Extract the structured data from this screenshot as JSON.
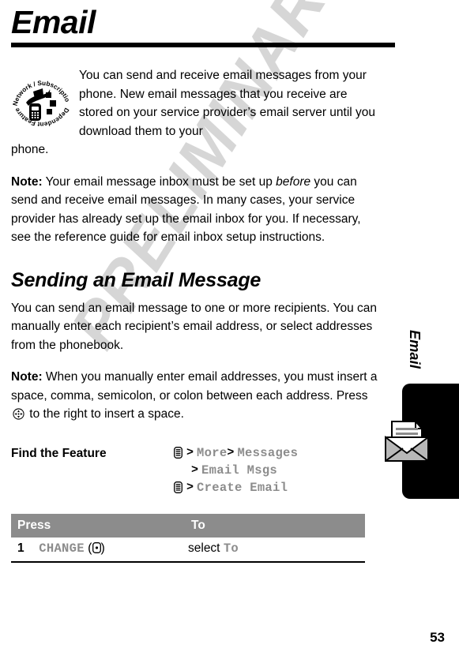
{
  "page": {
    "chapter_title": "Email",
    "page_number": "53",
    "watermark": "PRELIMINARY"
  },
  "badge": {
    "icon": "network-subscription-dependent-feature-badge",
    "top_text": "Network / Subscription",
    "bottom_text": "Dependent Feature"
  },
  "intro": {
    "text": "You can send and receive email messages from your phone. New email messages that you receive are stored on your service provider’s email server until you download them to your",
    "tail": "phone."
  },
  "note1": {
    "label": "Note:",
    "part1": "Your email message inbox must be set up ",
    "emphasis": "before",
    "part2": " you can send and receive email messages. In many cases, your service provider has already set up the email inbox for you. If necessary, see the reference guide for email inbox setup instructions."
  },
  "section": {
    "heading": "Sending an Email Message",
    "body": "You can send an email message to one or more recipients. You can manually enter each recipient’s email address, or select addresses from the phonebook."
  },
  "note2": {
    "label": "Note:",
    "part1": "When you manually enter email addresses, you must insert a space, comma, semicolon, or colon between each address. Press ",
    "glyph": "nav-key-icon",
    "part2": " to the right to insert a space."
  },
  "find_feature": {
    "label": "Find the Feature",
    "lines": [
      {
        "menu_key": "menu-key-icon",
        "show_menu_key": true,
        "indented": false,
        "segments": [
          {
            "sep": ">",
            "item": "More"
          },
          {
            "sep": ">",
            "item": "Messages"
          }
        ]
      },
      {
        "menu_key": "menu-key-icon",
        "show_menu_key": false,
        "indented": true,
        "segments": [
          {
            "sep": ">",
            "item": "Email Msgs"
          }
        ]
      },
      {
        "menu_key": "menu-key-icon",
        "show_menu_key": true,
        "indented": false,
        "segments": [
          {
            "sep": ">",
            "item": "Create Email"
          }
        ]
      }
    ]
  },
  "press_table": {
    "headers": {
      "press": "Press",
      "to": "To"
    },
    "rows": [
      {
        "num": "1",
        "press_label": "CHANGE",
        "press_key_icon": "soft-key-icon",
        "paren_open": "(",
        "paren_close": ")",
        "to_prefix": "select ",
        "to_mono": "To"
      }
    ]
  },
  "sidebar": {
    "label": "Email",
    "icon": "email-envelope-icon"
  }
}
